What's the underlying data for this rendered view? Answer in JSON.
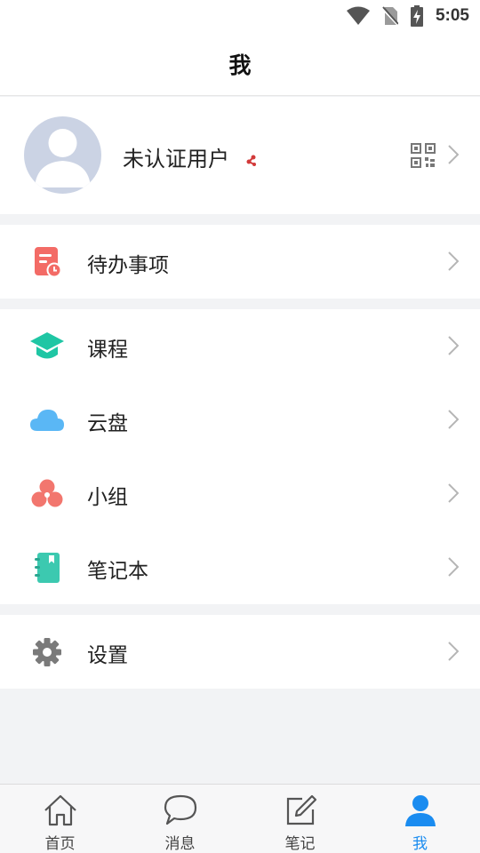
{
  "status_bar": {
    "time": "5:05",
    "icons": [
      "wifi-icon",
      "no-sim-icon",
      "battery-charging-icon"
    ]
  },
  "header": {
    "title": "我"
  },
  "profile": {
    "name": "未认证用户",
    "badge_icon": "unverified-badge-icon",
    "qr_icon": "qr-code-icon"
  },
  "menu": {
    "todo": {
      "label": "待办事项",
      "icon": "todo-icon",
      "color": "#f36b66"
    },
    "courses": {
      "label": "课程",
      "icon": "graduation-cap-icon",
      "color": "#1fc6a4"
    },
    "cloud": {
      "label": "云盘",
      "icon": "cloud-icon",
      "color": "#5ab7f5"
    },
    "groups": {
      "label": "小组",
      "icon": "group-icon",
      "color": "#f2766e"
    },
    "notebook": {
      "label": "笔记本",
      "icon": "notebook-icon",
      "color": "#3cc9b0"
    },
    "settings": {
      "label": "设置",
      "icon": "gear-icon",
      "color": "#7a7a7a"
    }
  },
  "tabbar": {
    "home": {
      "label": "首页",
      "icon": "home-icon"
    },
    "messages": {
      "label": "消息",
      "icon": "chat-bubble-icon"
    },
    "notes": {
      "label": "笔记",
      "icon": "edit-note-icon"
    },
    "me": {
      "label": "我",
      "icon": "user-icon",
      "active": true,
      "color": "#1a8cf0"
    }
  }
}
